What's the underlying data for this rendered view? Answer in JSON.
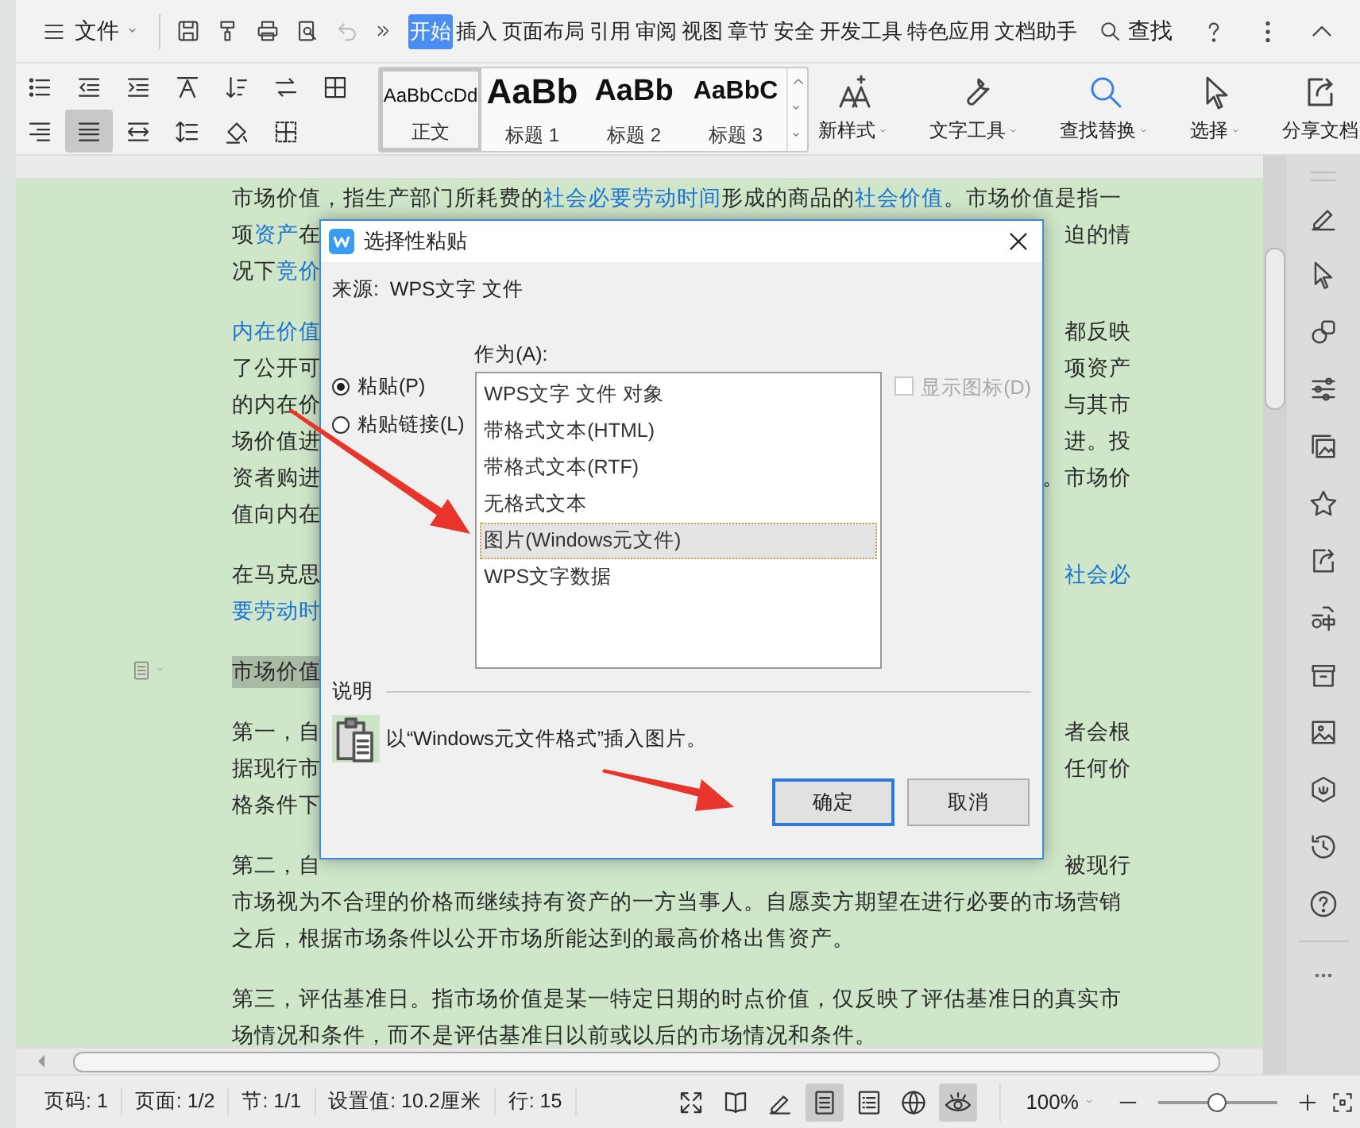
{
  "menu_bar": {
    "file_menu": "文件",
    "quick_access": [
      {
        "kind": "save",
        "disabled": false
      },
      {
        "kind": "painter",
        "disabled": false
      },
      {
        "kind": "print",
        "disabled": false
      },
      {
        "kind": "preview",
        "disabled": false
      },
      {
        "kind": "undo",
        "disabled": true
      },
      {
        "kind": "more",
        "disabled": false
      }
    ],
    "tabs": [
      {
        "label": "开始",
        "selected": true
      },
      {
        "label": "插入",
        "selected": false
      },
      {
        "label": "页面布局",
        "selected": false
      },
      {
        "label": "引用",
        "selected": false
      },
      {
        "label": "审阅",
        "selected": false
      },
      {
        "label": "视图",
        "selected": false
      },
      {
        "label": "章节",
        "selected": false
      },
      {
        "label": "安全",
        "selected": false
      },
      {
        "label": "开发工具",
        "selected": false
      },
      {
        "label": "特色应用",
        "selected": false
      },
      {
        "label": "文档助手",
        "selected": false
      }
    ],
    "search": "查找"
  },
  "ribbon": {
    "format_buttons": [
      {
        "kind": "list",
        "selected": false
      },
      {
        "kind": "outdent",
        "selected": false
      },
      {
        "kind": "indent",
        "selected": false
      },
      {
        "kind": "direction",
        "selected": false
      },
      {
        "kind": "sort",
        "selected": false
      },
      {
        "kind": "swap",
        "selected": false
      },
      {
        "kind": "table",
        "selected": false
      },
      {
        "kind": "align-right",
        "selected": false
      },
      {
        "kind": "justify",
        "selected": true
      },
      {
        "kind": "distribute",
        "selected": false
      },
      {
        "kind": "line-spacing",
        "selected": false
      },
      {
        "kind": "shading",
        "selected": false
      },
      {
        "kind": "borders",
        "selected": false
      }
    ],
    "styles": [
      {
        "preview": "AaBbCcDd",
        "label": "正文",
        "kind": "normal",
        "selected": true
      },
      {
        "preview": "AaBb",
        "label": "标题 1",
        "kind": "h1",
        "selected": false
      },
      {
        "preview": "AaBb",
        "label": "标题 2",
        "kind": "h2",
        "selected": false
      },
      {
        "preview": "AaBbC",
        "label": "标题 3",
        "kind": "h3",
        "selected": false
      }
    ],
    "tools": [
      {
        "kind": "new-style",
        "label": "新样式",
        "dropdown": true
      },
      {
        "kind": "text-tools",
        "label": "文字工具",
        "dropdown": true
      },
      {
        "kind": "find",
        "label": "查找替换",
        "dropdown": true
      },
      {
        "kind": "select",
        "label": "选择",
        "dropdown": true
      },
      {
        "kind": "share",
        "label": "分享文档",
        "dropdown": false
      }
    ]
  },
  "document": {
    "paragraphs": [
      {
        "kind": "body",
        "lines": [
          {
            "left": [
              {
                "t": "市场价值，指生产部门所耗费的",
                "link": false
              },
              {
                "t": "社会必要劳动时间",
                "link": true
              },
              {
                "t": "形成的商品的",
                "link": false
              },
              {
                "t": "社会价值",
                "link": true
              },
              {
                "t": "。市场价值是指一",
                "link": false
              }
            ]
          },
          {
            "left": [
              {
                "t": "项",
                "link": false
              },
              {
                "t": "资产",
                "link": true
              },
              {
                "t": "在",
                "link": false
              }
            ],
            "right": [
              {
                "t": "迫的情",
                "link": false
              }
            ]
          },
          {
            "left": [
              {
                "t": "况下",
                "link": false
              },
              {
                "t": "竞价",
                "link": true
              }
            ]
          }
        ]
      },
      {
        "kind": "body",
        "lines": [
          {
            "left": [
              {
                "t": "内在价值",
                "link": true
              }
            ],
            "right": [
              {
                "t": "都反映",
                "link": false
              }
            ]
          },
          {
            "left": [
              {
                "t": "了公开可",
                "link": false
              }
            ],
            "right": [
              {
                "t": "项资产",
                "link": false
              }
            ]
          },
          {
            "left": [
              {
                "t": "的内在价",
                "link": false
              }
            ],
            "right": [
              {
                "t": "与其市",
                "link": false
              }
            ]
          },
          {
            "left": [
              {
                "t": "场价值进",
                "link": false
              }
            ],
            "right": [
              {
                "t": "进。投",
                "link": false
              }
            ]
          },
          {
            "left": [
              {
                "t": "资者购进",
                "link": false
              }
            ],
            "right": [
              {
                "t": "。市场价",
                "link": false
              }
            ]
          },
          {
            "left": [
              {
                "t": "值向内在",
                "link": false
              }
            ]
          }
        ]
      },
      {
        "kind": "body",
        "lines": [
          {
            "left": [
              {
                "t": "在马克思",
                "link": false
              }
            ],
            "right": [
              {
                "t": "社会必",
                "link": true
              }
            ]
          },
          {
            "left": [
              {
                "t": "要劳动时",
                "link": true
              }
            ]
          }
        ]
      },
      {
        "kind": "heading",
        "lines": [
          {
            "left": [
              {
                "t": "市场价值",
                "link": false
              }
            ]
          }
        ]
      },
      {
        "kind": "body",
        "lines": [
          {
            "left": [
              {
                "t": "第一，自",
                "link": false
              }
            ],
            "right": [
              {
                "t": "者会根",
                "link": false
              }
            ]
          },
          {
            "left": [
              {
                "t": "据现行市",
                "link": false
              }
            ],
            "right": [
              {
                "t": "任何价",
                "link": false
              }
            ]
          },
          {
            "left": [
              {
                "t": "格条件下",
                "link": false
              }
            ]
          }
        ]
      },
      {
        "kind": "body",
        "lines": [
          {
            "left": [
              {
                "t": "第二，自",
                "link": false
              }
            ],
            "right": [
              {
                "t": "被现行",
                "link": false
              }
            ]
          },
          {
            "left": [
              {
                "t": "市场视为不合理的价格而继续持有资产的一方当事人。自愿卖方期望在进行必要的市场营销",
                "link": false
              }
            ]
          },
          {
            "left": [
              {
                "t": "之后，根据市场条件以公开市场所能达到的最高价格出售资产。",
                "link": false
              }
            ]
          }
        ]
      },
      {
        "kind": "body",
        "lines": [
          {
            "left": [
              {
                "t": "第三，评估基准日。指市场价值是某一特定日期的时点价值，仅反映了评估基准日的真实市",
                "link": false
              }
            ]
          },
          {
            "left": [
              {
                "t": "场情况和条件，而不是评估基准日以前或以后的市场情况和条件。",
                "link": false
              }
            ]
          }
        ]
      }
    ]
  },
  "dialog": {
    "title": "选择性粘贴",
    "source": "来源:  WPS文字 文件",
    "paste_options": [
      {
        "label": "粘贴(P)",
        "selected": true
      },
      {
        "label": "粘贴链接(L)",
        "selected": false
      }
    ],
    "list_label": "作为(A):",
    "formats": [
      {
        "label": "WPS文字 文件 对象",
        "selected": false
      },
      {
        "label": "带格式文本(HTML)",
        "selected": false
      },
      {
        "label": "带格式文本(RTF)",
        "selected": false
      },
      {
        "label": "无格式文本",
        "selected": false
      },
      {
        "label": "图片(Windows元文件)",
        "selected": true
      },
      {
        "label": "WPS文字数据",
        "selected": false
      }
    ],
    "show_icon": {
      "label": "显示图标(D)",
      "checked": false,
      "disabled": true
    },
    "description_label": "说明",
    "description": "以“Windows元文件格式”插入图片。",
    "buttons": [
      {
        "label": "确定",
        "default": true
      },
      {
        "label": "取消",
        "default": false
      }
    ]
  },
  "status_bar": {
    "items": [
      "页码: 1",
      "页面: 1/2",
      "节: 1/1",
      "设置值: 10.2厘米",
      "行: 15"
    ],
    "views": [
      {
        "kind": "fullscreen",
        "selected": false
      },
      {
        "kind": "reading",
        "selected": false
      },
      {
        "kind": "edit",
        "selected": false
      },
      {
        "kind": "page",
        "selected": true
      },
      {
        "kind": "outline",
        "selected": false
      },
      {
        "kind": "web",
        "selected": false
      },
      {
        "kind": "eye",
        "selected": true
      }
    ],
    "zoom": "100%",
    "zoom_slider": {
      "level": 0.5
    }
  }
}
